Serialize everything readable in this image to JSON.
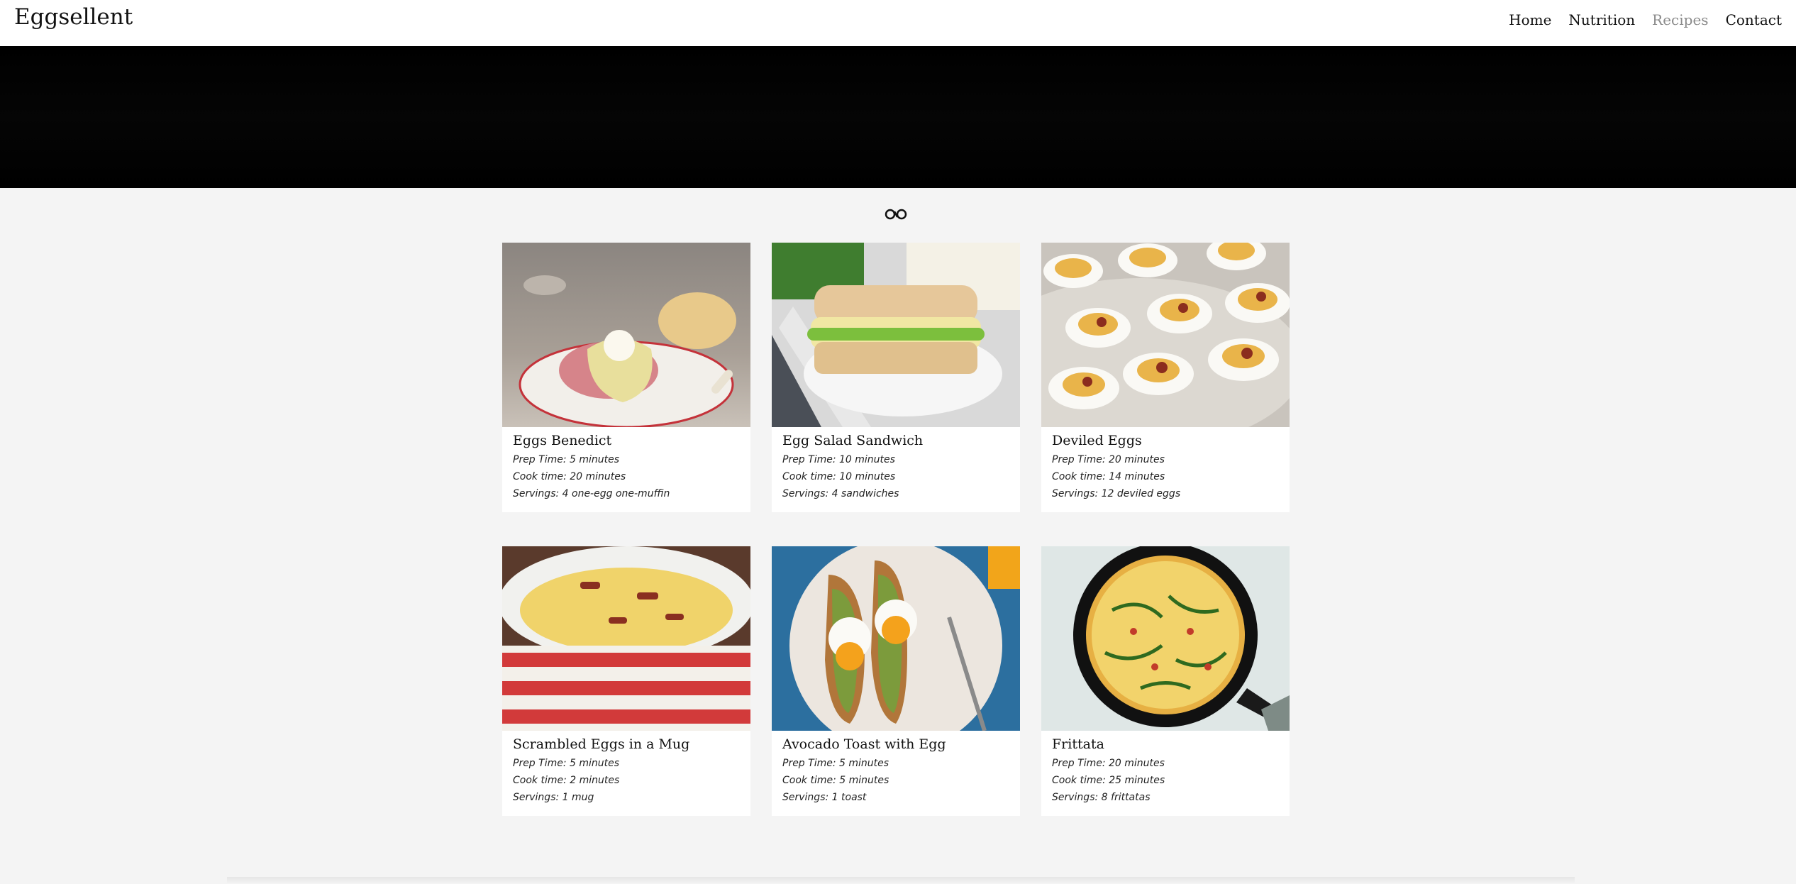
{
  "header": {
    "brand": "Eggsellent",
    "nav": [
      {
        "label": "Home",
        "active": false
      },
      {
        "label": "Nutrition",
        "active": false
      },
      {
        "label": "Recipes",
        "active": true
      },
      {
        "label": "Contact",
        "active": false
      }
    ]
  },
  "toggle_icon": "infinity-toggle-icon",
  "recipes": [
    {
      "title": "Eggs Benedict",
      "prep": "Prep Time: 5 minutes",
      "cook": "Cook time: 20 minutes",
      "servings": "Servings: 4 one-egg one-muffin"
    },
    {
      "title": "Egg Salad Sandwich",
      "prep": "Prep Time: 10 minutes",
      "cook": "Cook time: 10 minutes",
      "servings": "Servings: 4 sandwiches"
    },
    {
      "title": "Deviled Eggs",
      "prep": "Prep Time: 20 minutes",
      "cook": "Cook time: 14 minutes",
      "servings": "Servings: 12 deviled eggs"
    },
    {
      "title": "Scrambled Eggs in a Mug",
      "prep": "Prep Time: 5 minutes",
      "cook": "Cook time: 2 minutes",
      "servings": "Servings: 1 mug"
    },
    {
      "title": "Avocado Toast with Egg",
      "prep": "Prep Time: 5 minutes",
      "cook": "Cook time: 5 minutes",
      "servings": "Servings: 1 toast"
    },
    {
      "title": "Frittata",
      "prep": "Prep Time: 20 minutes",
      "cook": "Cook time: 25 minutes",
      "servings": "Servings: 8 frittatas"
    }
  ],
  "colors": {
    "page_bg": "#f4f4f4",
    "hero_bg": "#000000",
    "nav_active": "#8a8a8a"
  }
}
